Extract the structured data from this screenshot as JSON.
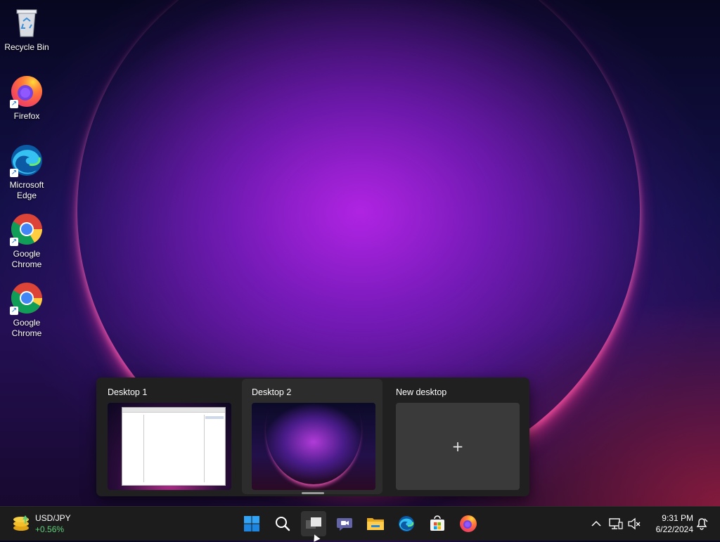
{
  "desktop": {
    "icons": [
      {
        "label": "Recycle Bin",
        "icon": "recycle-bin-icon"
      },
      {
        "label": "Firefox",
        "icon": "firefox-icon"
      },
      {
        "label": "Microsoft Edge",
        "icon": "edge-icon"
      },
      {
        "label": "Google Chrome",
        "icon": "chrome-icon"
      },
      {
        "label": "Google Chrome",
        "icon": "chrome-icon"
      }
    ]
  },
  "task_view": {
    "desktops": [
      {
        "label": "Desktop 1",
        "active": false
      },
      {
        "label": "Desktop 2",
        "active": true
      },
      {
        "label": "New desktop",
        "active": false
      }
    ],
    "new_desktop_glyph": "+"
  },
  "taskbar": {
    "widget": {
      "symbol": "USD/JPY",
      "change": "+0.56%",
      "change_color": "#5fd07a"
    },
    "apps": [
      "start-icon",
      "search-icon",
      "task-view-icon",
      "teams-chat-icon",
      "file-explorer-icon",
      "edge-icon",
      "store-icon",
      "firefox-icon"
    ],
    "clock": {
      "time": "9:31 PM",
      "date": "6/22/2024"
    }
  },
  "colors": {
    "accent": "#0078d4",
    "taskbar": "#1c1c1c",
    "panel": "#202020"
  }
}
